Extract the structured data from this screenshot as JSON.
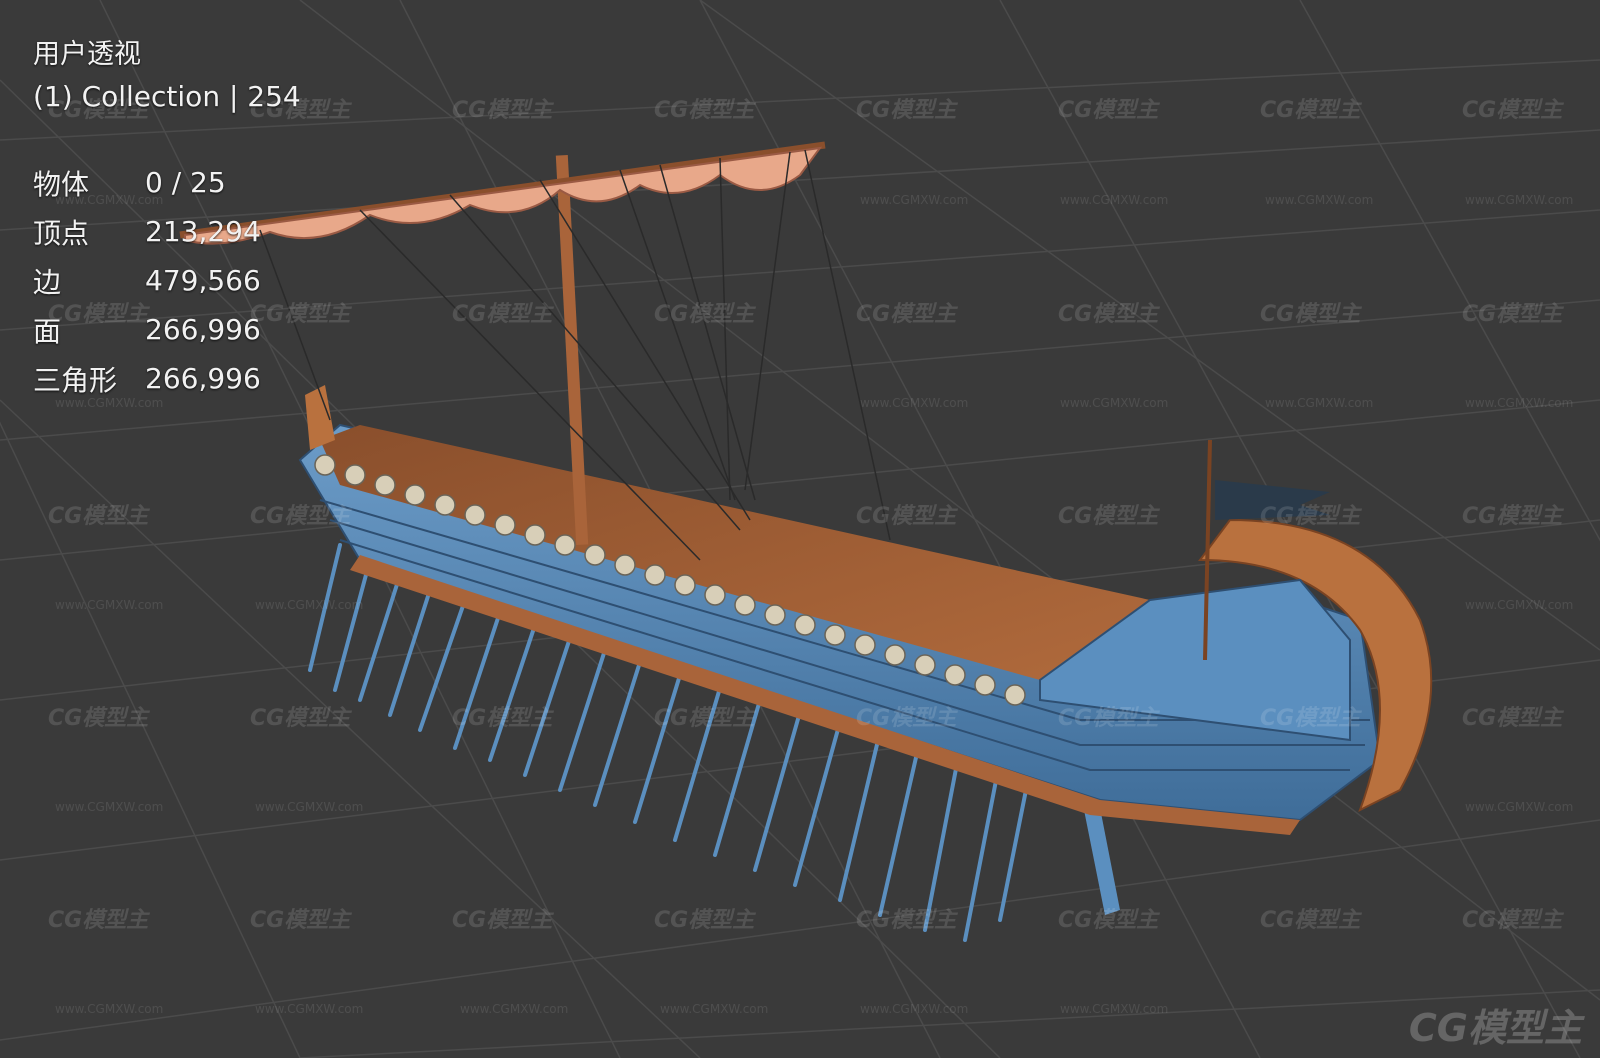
{
  "viewport": {
    "view_name": "用户透视",
    "collection_label": "(1) Collection | 254",
    "stats": [
      {
        "label": "物体",
        "value": "0 / 25"
      },
      {
        "label": "顶点",
        "value": "213,294"
      },
      {
        "label": "边",
        "value": "479,566"
      },
      {
        "label": "面",
        "value": "266,996"
      },
      {
        "label": "三角形",
        "value": "266,996"
      }
    ]
  },
  "watermark": {
    "logo_text": "CG模型主",
    "url_text": "www.CGMXW.com"
  },
  "colors": {
    "background": "#3a3a3a",
    "grid": "#4a4a4a",
    "hull_blue": "#5b8fbf",
    "wood": "#a9643a",
    "sail": "#e8a88a"
  }
}
